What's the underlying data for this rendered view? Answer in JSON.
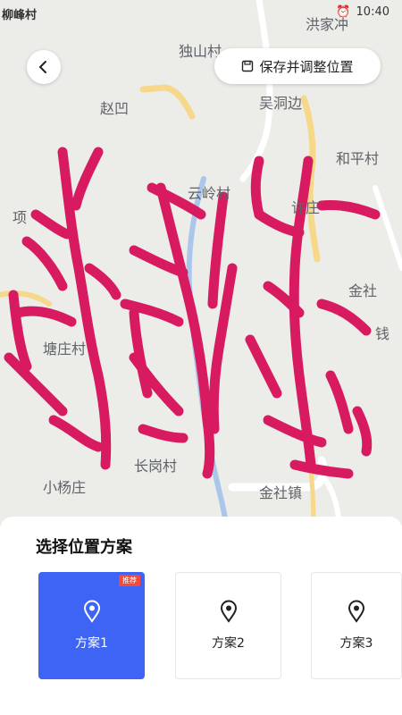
{
  "status_bar": {
    "left_text": "柳峰村",
    "right_text": "10:40"
  },
  "map": {
    "places": [
      "洪家冲",
      "独山村",
      "赵凹",
      "吴洞边",
      "和平村",
      "云岭村",
      "许庄",
      "项",
      "金社",
      "塘庄村",
      "钱",
      "长岗村",
      "小杨庄",
      "金社镇"
    ],
    "overlay_color": "#d81b60"
  },
  "toolbar": {
    "back_icon": "chevron-left-icon",
    "save_label": "保存并调整位置"
  },
  "sheet": {
    "title": "选择位置方案",
    "options": [
      {
        "label": "方案1",
        "badge": "推荐",
        "selected": true
      },
      {
        "label": "方案2",
        "selected": false
      },
      {
        "label": "方案3",
        "selected": false
      }
    ]
  },
  "colors": {
    "accent": "#3d64f4",
    "badge": "#f24b3d",
    "road_yellow": "#f5d889",
    "river": "#aac6ea"
  }
}
